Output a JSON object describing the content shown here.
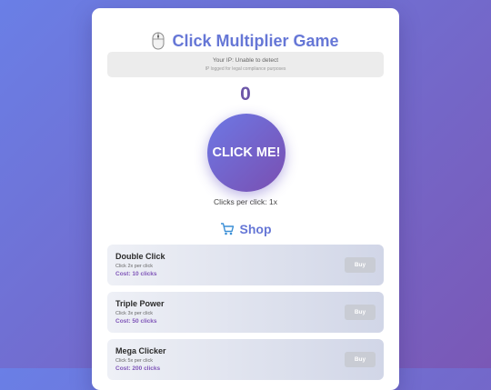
{
  "header": {
    "title": "Click Multiplier Game",
    "icon": "mouse-icon"
  },
  "ip_notice": {
    "line": "Your IP: Unable to detect",
    "note": "IP logged for legal compliance purposes"
  },
  "game": {
    "score": "0",
    "click_button_label": "CLICK ME!",
    "clicks_per_click": "Clicks per click: 1x"
  },
  "shop": {
    "title": "Shop",
    "icon": "shopping-cart-icon",
    "items": [
      {
        "name": "Double Click",
        "desc": "Click 2x per click",
        "cost": "Cost: 10 clicks",
        "buy_label": "Buy"
      },
      {
        "name": "Triple Power",
        "desc": "Click 3x per click",
        "cost": "Cost: 50 clicks",
        "buy_label": "Buy"
      },
      {
        "name": "Mega Clicker",
        "desc": "Click 5x per click",
        "cost": "Cost: 200 clicks",
        "buy_label": "Buy"
      }
    ]
  },
  "colors": {
    "accent": "#6677d6",
    "score": "#6c56a8",
    "cost": "#7f55b8",
    "buy_disabled": "#c9ccd4",
    "background_start": "#6a7fe6",
    "background_end": "#7a58b6"
  }
}
